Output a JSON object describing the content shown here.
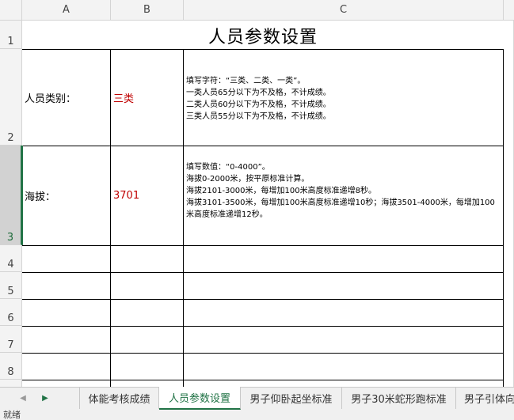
{
  "columns": [
    "A",
    "B",
    "C"
  ],
  "rows": [
    "1",
    "2",
    "3",
    "4",
    "5",
    "6",
    "7",
    "8"
  ],
  "sheet": {
    "title": "人员参数设置",
    "row2": {
      "label": "人员类别：",
      "value": "三类",
      "notes": "填写字符：“三类、二类、一类”。\n一类人员65分以下为不及格，不计成绩。\n二类人员60分以下为不及格，不计成绩。\n三类人员55分以下为不及格，不计成绩。"
    },
    "row3": {
      "label": "海拔：",
      "value": "3701",
      "notes": "填写数值：“0-4000”。\n海拔0-2000米，按平原标准计算。\n海拔2101-3000米，每增加100米高度标准递增8秒。\n海拔3101-3500米，每增加100米高度标准递增10秒；海拔3501-4000米，每增加100米高度标准递增12秒。"
    }
  },
  "tabs": [
    "体能考核成绩",
    "人员参数设置",
    "男子仰卧起坐标准",
    "男子30米蛇形跑标准",
    "男子引体向"
  ],
  "active_tab": "人员参数设置",
  "status": "就绪",
  "colors": {
    "accent": "#217346",
    "value_red": "#c00000",
    "header_bg": "#f3f3f3"
  }
}
